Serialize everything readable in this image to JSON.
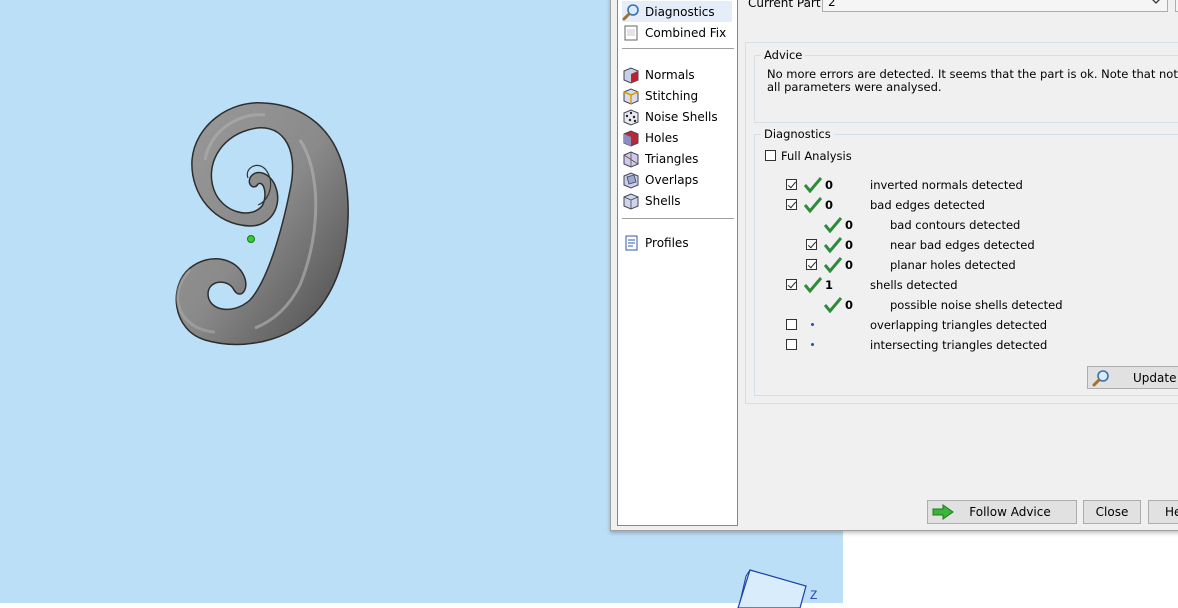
{
  "nav": {
    "items": [
      {
        "label": "Diagnostics",
        "icon": "magnifier-icon",
        "selected": true
      },
      {
        "label": "Combined Fix",
        "icon": "page-icon"
      },
      {
        "label": "Normals",
        "icon": "cube-red-face-icon"
      },
      {
        "label": "Stitching",
        "icon": "cube-stitching-icon"
      },
      {
        "label": "Noise Shells",
        "icon": "cube-dotted-icon"
      },
      {
        "label": "Holes",
        "icon": "cube-hole-icon"
      },
      {
        "label": "Triangles",
        "icon": "cube-triangles-icon"
      },
      {
        "label": "Overlaps",
        "icon": "cube-overlaps-icon"
      },
      {
        "label": "Shells",
        "icon": "cube-shells-icon"
      },
      {
        "label": "Profiles",
        "icon": "profile-page-icon"
      }
    ]
  },
  "current_part": {
    "label": "Current Part:",
    "value": "2"
  },
  "advice": {
    "title": "Advice",
    "text": "No more errors are detected. It seems that the part is ok. Note that not all parameters were analysed."
  },
  "diagnostics": {
    "title": "Diagnostics",
    "full_analysis_label": "Full Analysis",
    "full_analysis_checked": false,
    "rows": [
      {
        "label": "inverted normals detected",
        "count": "0",
        "checked": true,
        "status": "ok",
        "indent": 0
      },
      {
        "label": "bad edges detected",
        "count": "0",
        "checked": true,
        "status": "ok",
        "indent": 0
      },
      {
        "label": "bad contours detected",
        "count": "0",
        "checked": null,
        "status": "ok",
        "indent": 1
      },
      {
        "label": "near bad edges detected",
        "count": "0",
        "checked": true,
        "status": "ok",
        "indent": 1
      },
      {
        "label": "planar holes detected",
        "count": "0",
        "checked": true,
        "status": "ok",
        "indent": 1
      },
      {
        "label": "shells detected",
        "count": "1",
        "checked": true,
        "status": "ok",
        "indent": 0
      },
      {
        "label": "possible noise shells detected",
        "count": "0",
        "checked": null,
        "status": "ok",
        "indent": 1
      },
      {
        "label": "overlapping triangles detected",
        "count": "",
        "checked": false,
        "status": "not-analysed",
        "indent": 0
      },
      {
        "label": "intersecting triangles detected",
        "count": "",
        "checked": false,
        "status": "not-analysed",
        "indent": 0
      }
    ],
    "update_label": "Update"
  },
  "buttons": {
    "follow_advice": "Follow Advice",
    "close": "Close",
    "help": "He"
  },
  "viewport": {
    "axis_label": "Z",
    "background": "#bcdff8"
  },
  "colors": {
    "check_green": "#2e8b3e",
    "arrow_green": "#3cb43c",
    "selection": "#e5eef8"
  }
}
